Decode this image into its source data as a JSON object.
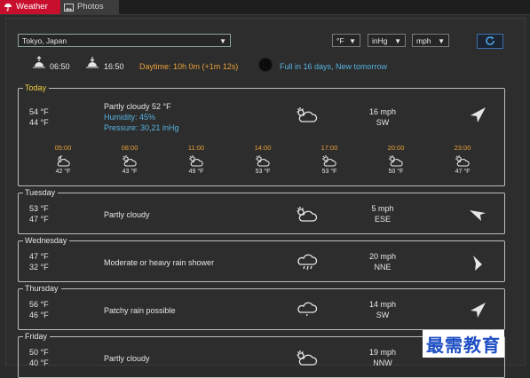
{
  "tabs": [
    {
      "label": "Weather",
      "icon": "umbrella-icon",
      "active": true
    },
    {
      "label": "Photos",
      "icon": "photo-icon",
      "active": false
    }
  ],
  "controls": {
    "location": "Tokyo, Japan",
    "temp_unit": "°F",
    "pressure_unit": "inHg",
    "speed_unit": "mph",
    "refresh_icon": "refresh-icon"
  },
  "astro": {
    "sunrise": "06:50",
    "sunset": "16:50",
    "daytime": "Daytime: 10h 0m (+1m 12s)",
    "moon": "Full in 16 days, New tomorrow"
  },
  "today": {
    "label": "Today",
    "high": "54 °F",
    "low": "44 °F",
    "condition": "Partly cloudy 52 °F",
    "humidity": "Humidity: 45%",
    "pressure": "Pressure: 30,21 inHg",
    "wind_speed": "16 mph",
    "wind_dir": "SW",
    "icon": "partly-cloudy-icon",
    "hourly": [
      {
        "time": "05:00",
        "temp": "42 °F",
        "icon": "moon-cloud-icon"
      },
      {
        "time": "08:00",
        "temp": "43 °F",
        "icon": "partly-cloudy-icon"
      },
      {
        "time": "11:00",
        "temp": "49 °F",
        "icon": "partly-cloudy-icon"
      },
      {
        "time": "14:00",
        "temp": "53 °F",
        "icon": "partly-cloudy-icon"
      },
      {
        "time": "17:00",
        "temp": "53 °F",
        "icon": "partly-cloudy-icon"
      },
      {
        "time": "20:00",
        "temp": "50 °F",
        "icon": "partly-cloudy-icon"
      },
      {
        "time": "23:00",
        "temp": "47 °F",
        "icon": "partly-cloudy-icon"
      }
    ]
  },
  "days": [
    {
      "label": "Tuesday",
      "high": "53 °F",
      "low": "47 °F",
      "condition": "Partly cloudy",
      "wind_speed": "5 mph",
      "wind_dir": "ESE",
      "icon": "partly-cloudy-icon"
    },
    {
      "label": "Wednesday",
      "high": "47 °F",
      "low": "32 °F",
      "condition": "Moderate or heavy rain shower",
      "wind_speed": "20 mph",
      "wind_dir": "NNE",
      "icon": "rain-cloud-icon"
    },
    {
      "label": "Thursday",
      "high": "56 °F",
      "low": "46 °F",
      "condition": "Patchy rain possible",
      "wind_speed": "14 mph",
      "wind_dir": "SW",
      "icon": "drizzle-cloud-icon"
    },
    {
      "label": "Friday",
      "high": "50 °F",
      "low": "40 °F",
      "condition": "Partly cloudy",
      "wind_speed": "19 mph",
      "wind_dir": "NNW",
      "icon": "partly-cloudy-icon"
    }
  ],
  "watermark": "最需教育",
  "colors": {
    "accent_tab": "#c8102e",
    "orange": "#e8a13a",
    "blue": "#57b2e0",
    "today_label": "#f0d040"
  }
}
